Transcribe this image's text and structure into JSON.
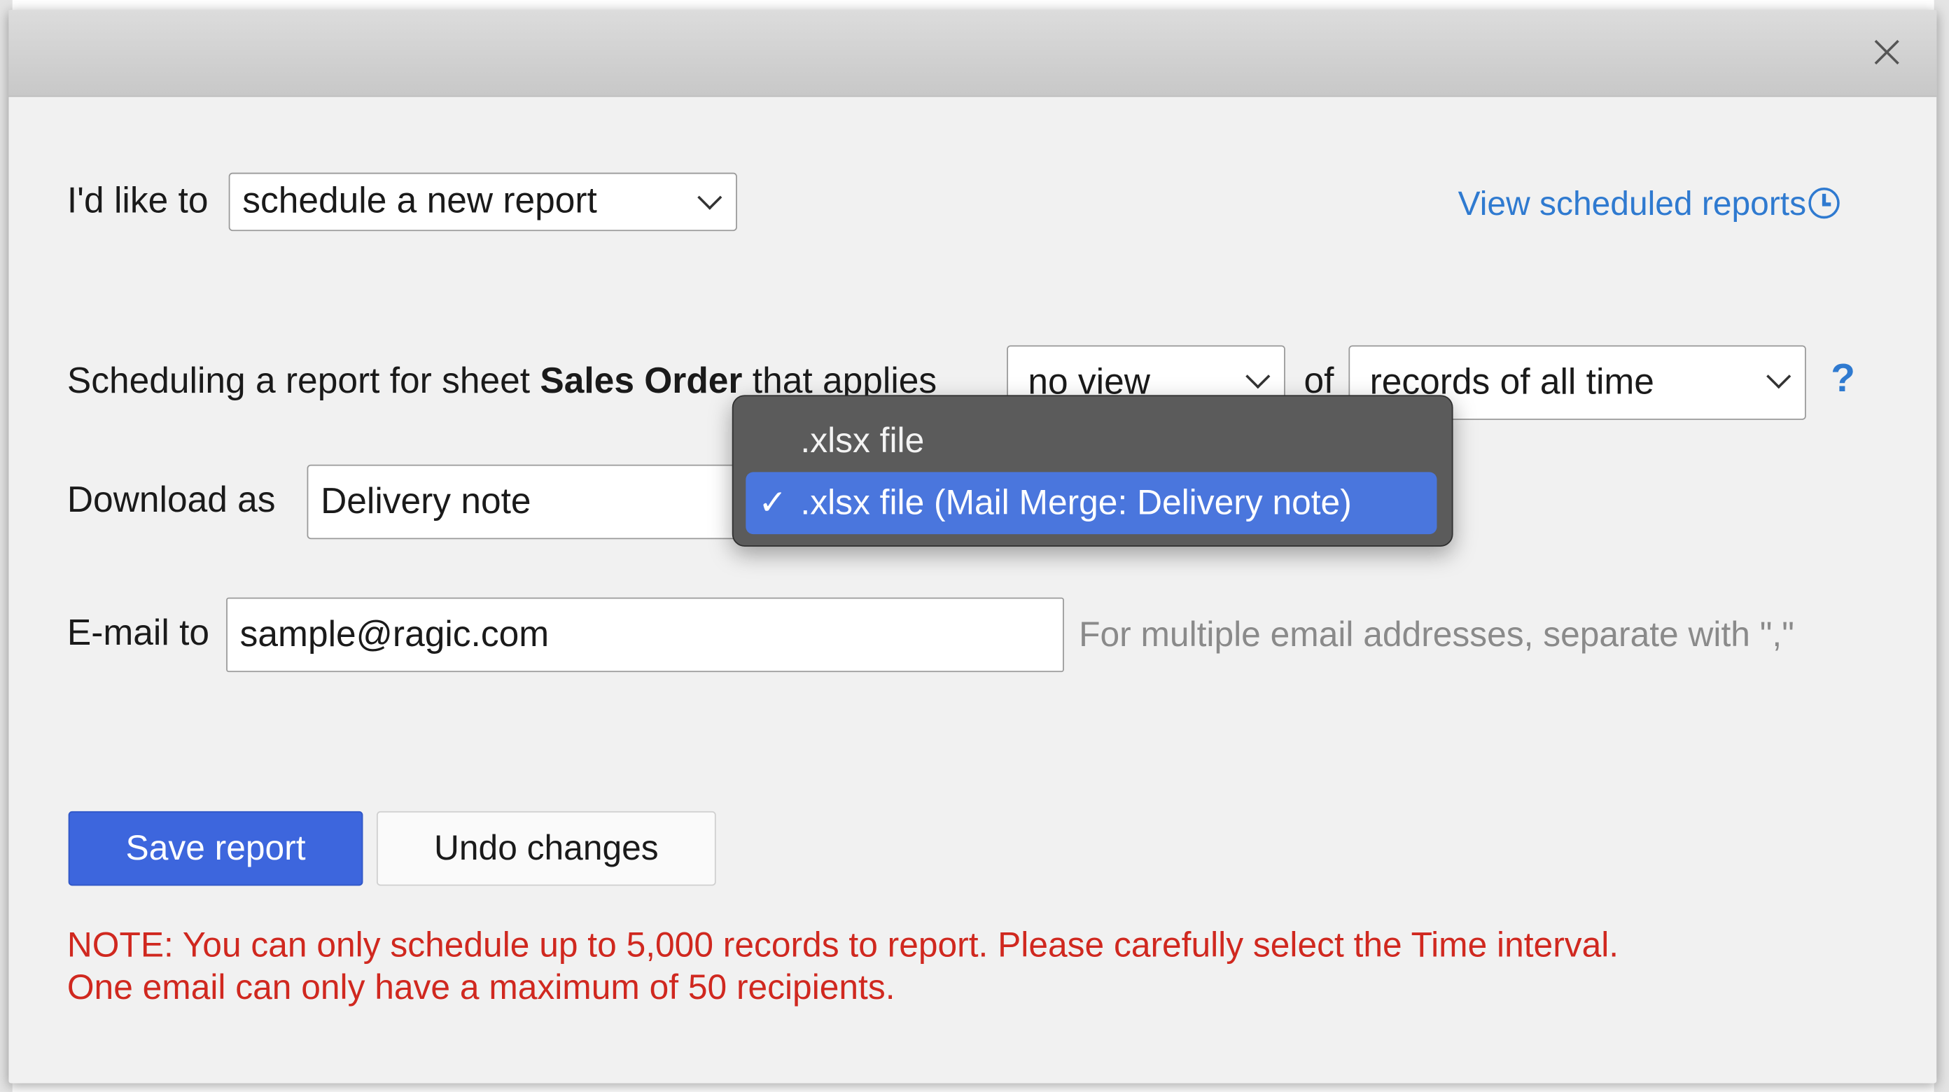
{
  "dialog": {
    "close_label": "×"
  },
  "form": {
    "intent_label": "I'd like to",
    "intent_value": "schedule a new report",
    "view_link": "View scheduled reports",
    "sched_prefix": "Scheduling a report for sheet ",
    "sheet_name": "Sales Order",
    "sched_suffix": " that applies",
    "view_value": "no view",
    "of_label": "of",
    "range_value": "records of all time",
    "help": "?",
    "download_label": "Download as",
    "download_value": "Delivery note",
    "email_label": "E-mail to",
    "email_value": "sample@ragic.com",
    "email_hint": "For multiple email addresses, separate with \",\""
  },
  "dropdown": {
    "options": [
      {
        "label": ".xlsx file",
        "selected": false
      },
      {
        "label": ".xlsx file (Mail Merge: Delivery note)",
        "selected": true
      }
    ],
    "check_glyph": "✓"
  },
  "buttons": {
    "save_label": "Save report",
    "undo_label": "Undo changes"
  },
  "notes": {
    "line1": "NOTE: You can only schedule up to 5,000 records to report. Please carefully select the Time interval.",
    "line2": "One email can only have a maximum of 50 recipients."
  },
  "colors": {
    "accent": "#3d66dd",
    "link": "#2f7ad0",
    "warning": "#d0281f",
    "menu_bg": "#5b5b5b",
    "menu_selected": "#4a76dd"
  }
}
